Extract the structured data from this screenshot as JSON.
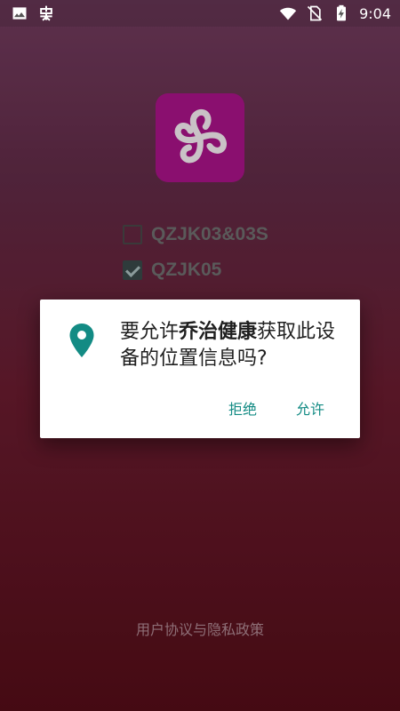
{
  "status_bar": {
    "icons_left": [
      "image-icon",
      "notification-app-icon"
    ],
    "icons_right": [
      "wifi-icon",
      "no-sim-icon",
      "battery-charging-icon"
    ],
    "time": "9:04"
  },
  "app": {
    "icon_name": "app-logo-icon",
    "accent": "#8a0f6f"
  },
  "devices": [
    {
      "label": "QZJK03&03S",
      "checked": false
    },
    {
      "label": "QZJK05",
      "checked": true
    }
  ],
  "dialog": {
    "icon_name": "location-pin-icon",
    "message_prefix": "要允许",
    "app_name": "乔治健康",
    "message_suffix": "获取此设备的位置信息吗?",
    "deny_label": "拒绝",
    "allow_label": "允许",
    "accent": "#138b84"
  },
  "footer": {
    "link_label": "用户协议与隐私政策"
  }
}
